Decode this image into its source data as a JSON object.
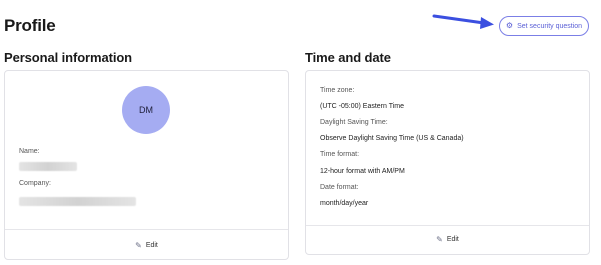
{
  "page": {
    "title": "Profile"
  },
  "header": {
    "security_button_label": "Set security question"
  },
  "personal": {
    "title": "Personal information",
    "avatar_initials": "DM",
    "name_label": "Name:",
    "company_label": "Company:",
    "edit_label": "Edit"
  },
  "timedate": {
    "title": "Time and date",
    "timezone_label": "Time zone:",
    "timezone_value": "(UTC -05:00) Eastern Time",
    "dst_label": "Daylight Saving Time:",
    "dst_value": "Observe Daylight Saving Time (US & Canada)",
    "format_label": "Time format:",
    "format_value": "12-hour format with AM/PM",
    "date_label": "Date format:",
    "date_value": "month/day/year",
    "edit_label": "Edit"
  },
  "icons": {
    "security_button": "gear-icon",
    "edit": "pencil-icon",
    "annotation": "arrow-icon"
  },
  "colors": {
    "accent": "#5a5fd6",
    "avatar_bg": "#a5acf2",
    "arrow": "#3b4fe0"
  }
}
